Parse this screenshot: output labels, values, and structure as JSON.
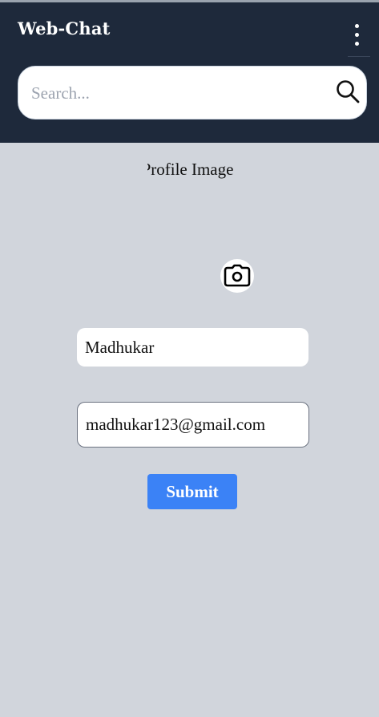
{
  "header": {
    "title": "Web-Chat",
    "menu_icon": "kebab-menu-icon",
    "background": "#1e293b"
  },
  "search": {
    "placeholder": "Search...",
    "value": "",
    "icon": "search-icon"
  },
  "profile": {
    "label": "Profile Image",
    "camera_icon": "camera-icon"
  },
  "form": {
    "name_value": "Madhukar",
    "email_value": "madhukar123@gmail.com",
    "submit_label": "Submit",
    "submit_color": "#3b82f6"
  },
  "page": {
    "background": "#d1d5dc"
  }
}
